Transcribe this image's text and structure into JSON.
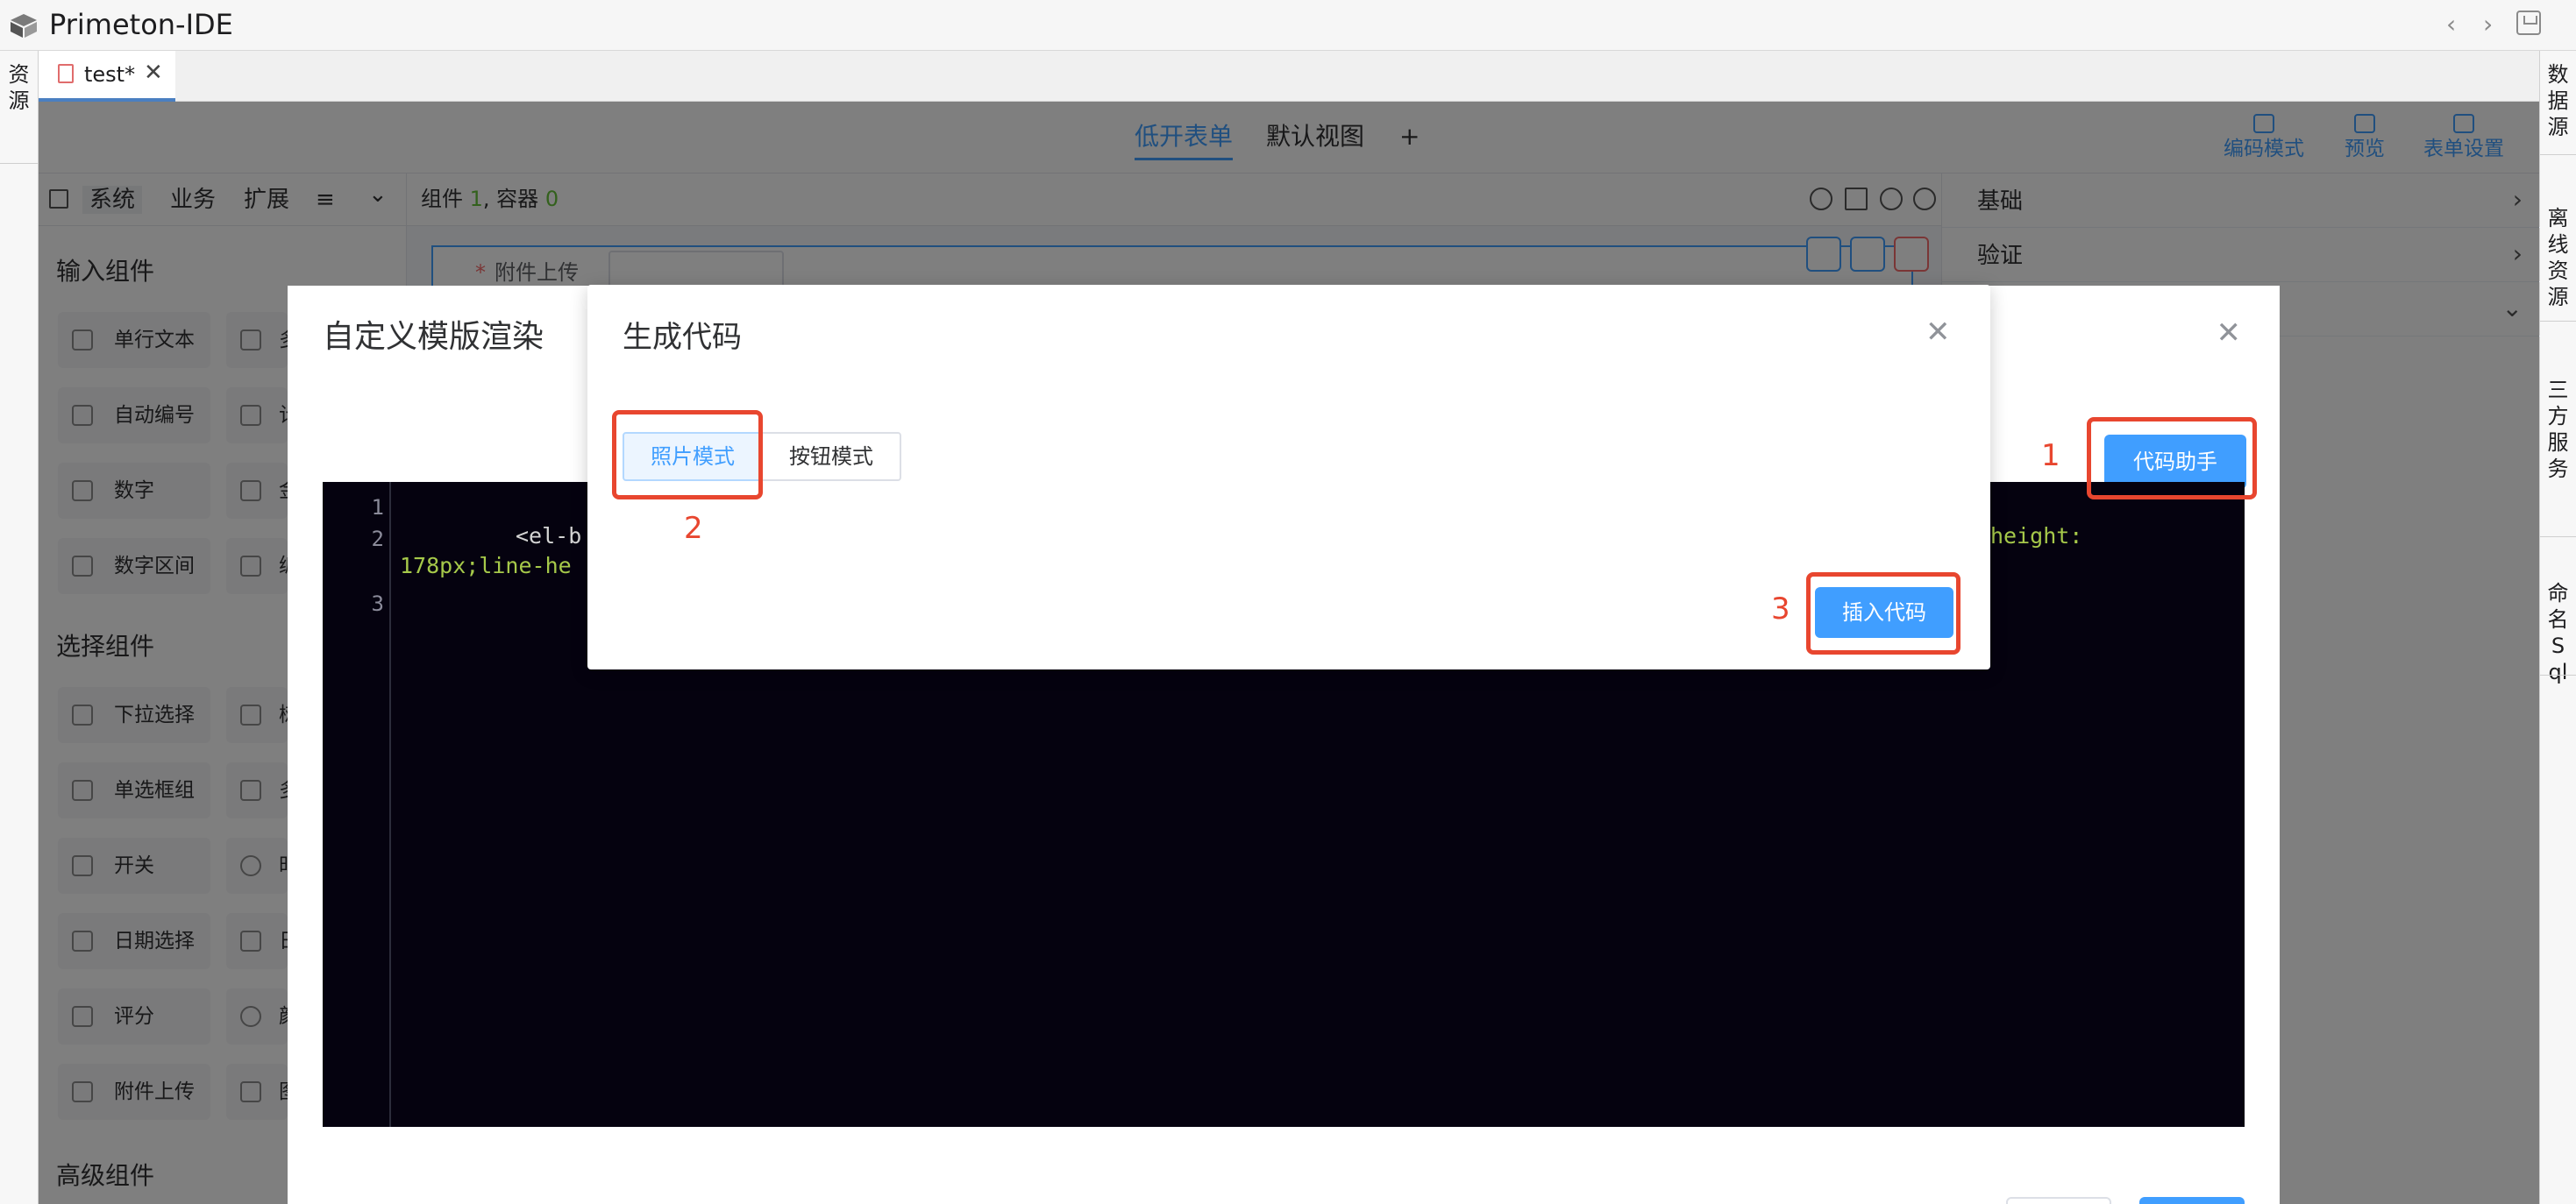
{
  "window": {
    "title": "Primeton-IDE",
    "back_glyph": "‹",
    "forward_glyph": "›"
  },
  "side_left": {
    "tabs": [
      {
        "label": "资源"
      }
    ]
  },
  "side_right": {
    "tabs": [
      {
        "label": "数据源"
      },
      {
        "label": "离线资源"
      },
      {
        "label": "三方服务"
      },
      {
        "label": "命名Sql"
      }
    ]
  },
  "editor_tab": {
    "label": "test*",
    "close_glyph": "✕"
  },
  "form_tabs": {
    "items": [
      {
        "label": "低开表单"
      },
      {
        "label": "默认视图"
      },
      {
        "label": "+"
      }
    ],
    "active": "低开表单"
  },
  "toolbar": {
    "code_mode": "编码模式",
    "preview": "预览",
    "form_settings": "表单设置"
  },
  "palette": {
    "tabs": [
      {
        "label": "系统"
      },
      {
        "label": "业务"
      },
      {
        "label": "扩展"
      },
      {
        "label": "≡"
      },
      {
        "label": "⌄"
      }
    ],
    "sections": [
      {
        "title": "输入组件",
        "items": [
          {
            "label": "单行文本",
            "partial": "多"
          },
          {
            "label": "自动编号",
            "partial": "计"
          },
          {
            "label": "数字",
            "partial": "金"
          },
          {
            "label": "数字区间",
            "partial": "编"
          }
        ]
      },
      {
        "title": "选择组件",
        "items": [
          {
            "label": "下拉选择",
            "partial": "树"
          },
          {
            "label": "单选框组",
            "partial": "多"
          },
          {
            "label": "开关",
            "partial": "时"
          },
          {
            "label": "日期选择",
            "partial": "日"
          },
          {
            "label": "评分",
            "partial": "颜"
          },
          {
            "label": "附件上传",
            "partial": "图"
          }
        ]
      },
      {
        "title": "高级组件",
        "items": []
      }
    ]
  },
  "canvas": {
    "stats_prefix": "组件",
    "stats_components": "1",
    "stats_container_label": ", 容器",
    "stats_containers": "0",
    "field_label": "附件上传"
  },
  "properties": {
    "rows": [
      {
        "label": "基础",
        "chevron": "›"
      },
      {
        "label": "验证",
        "chevron": "›"
      },
      {
        "label": "",
        "chevron": "⌄"
      }
    ]
  },
  "dialog_mid": {
    "title": "自定义模版渲染",
    "close_glyph": "✕",
    "code_assist_label": "代码助手",
    "editor": {
      "line_numbers": [
        "1",
        "2",
        "3"
      ],
      "line2_left": "<el-b",
      "line2_right": "height:",
      "line2_wrap": "178px;line-he"
    }
  },
  "dialog_top": {
    "title": "生成代码",
    "close_glyph": "✕",
    "modes": [
      {
        "label": "照片模式",
        "active": true
      },
      {
        "label": "按钮模式",
        "active": false
      }
    ],
    "insert_label": "插入代码"
  },
  "annotations": {
    "one": "1",
    "two": "2",
    "three": "3"
  },
  "colors": {
    "primary": "#409eff",
    "annotation": "#e8462f",
    "editor_bg": "#05020f",
    "overlay": "rgba(0,0,0,0.5)"
  }
}
